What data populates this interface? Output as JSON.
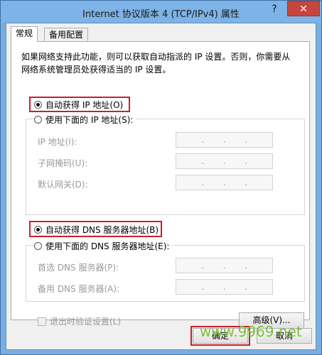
{
  "window": {
    "title": "Internet 协议版本 4 (TCP/IPv4) 属性",
    "help_glyph": "?",
    "close_glyph": "✕"
  },
  "tabs": [
    {
      "label": "常规",
      "active": true
    },
    {
      "label": "备用配置",
      "active": false
    }
  ],
  "description": "如果网络支持此功能，则可以获取自动指派的 IP 设置。否则，你需要从网络系统管理员处获得适当的 IP 设置。",
  "ip": {
    "auto_label": "自动获得 IP 地址(O)",
    "manual_label": "使用下面的 IP 地址(S):",
    "fields": [
      {
        "label": "IP 地址(I):"
      },
      {
        "label": "子网掩码(U):"
      },
      {
        "label": "默认网关(D):"
      }
    ]
  },
  "dns": {
    "auto_label": "自动获得 DNS 服务器地址(B)",
    "manual_label": "使用下面的 DNS 服务器地址(E):",
    "fields": [
      {
        "label": "首选 DNS 服务器(P):"
      },
      {
        "label": "备用 DNS 服务器(A):"
      }
    ]
  },
  "validate_on_exit_label": "退出时验证设置(L)",
  "advanced_button": "高级(V)...",
  "ok_button": "确定",
  "cancel_button": "取消",
  "watermark": "www.9969.net",
  "colors": {
    "highlight_box": "#c8202a",
    "close_button": "#c7453c",
    "title_bar": "#7db3e6",
    "watermark": "#7fbf3a"
  }
}
